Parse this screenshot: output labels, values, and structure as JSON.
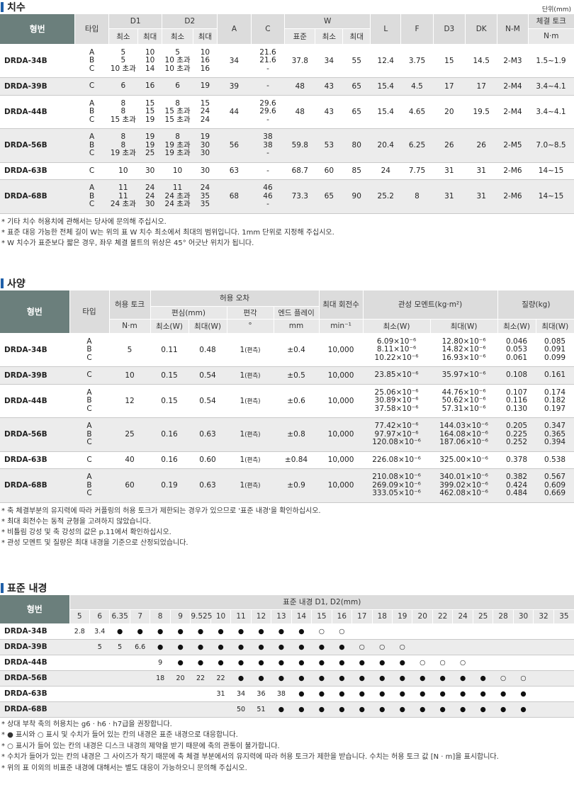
{
  "dimensions": {
    "title": "치수",
    "unit": "단위(mm)",
    "headers": {
      "model": "형번",
      "type": "타입",
      "d1": "D1",
      "d2": "D2",
      "min": "최소",
      "max": "최대",
      "a": "A",
      "c": "C",
      "w": "W",
      "std": "표준",
      "l": "L",
      "f": "F",
      "d3": "D3",
      "dk": "DK",
      "nm": "N-M",
      "torque": "체결 토크",
      "torque_unit": "N·m"
    },
    "rows": [
      {
        "model": "DRDA-34B",
        "types": [
          "A",
          "B",
          "C"
        ],
        "d1min": [
          "5",
          "5",
          "10 초과"
        ],
        "d1max": [
          "10",
          "10",
          "14"
        ],
        "d2min": [
          "5",
          "10 초과",
          "10 초과"
        ],
        "d2max": [
          "10",
          "16",
          "16"
        ],
        "a": "34",
        "c": [
          "21.6",
          "21.6",
          "-"
        ],
        "wstd": "37.8",
        "wmin": "34",
        "wmax": "55",
        "l": "12.4",
        "f": "3.75",
        "d3": "15",
        "dk": "14.5",
        "nm": "2-M3",
        "torque": "1.5~1.9"
      },
      {
        "model": "DRDA-39B",
        "types": [
          "C"
        ],
        "d1min": [
          "6"
        ],
        "d1max": [
          "16"
        ],
        "d2min": [
          "6"
        ],
        "d2max": [
          "19"
        ],
        "a": "39",
        "c": [
          "-"
        ],
        "wstd": "48",
        "wmin": "43",
        "wmax": "65",
        "l": "15.4",
        "f": "4.5",
        "d3": "17",
        "dk": "17",
        "nm": "2-M4",
        "torque": "3.4~4.1"
      },
      {
        "model": "DRDA-44B",
        "types": [
          "A",
          "B",
          "C"
        ],
        "d1min": [
          "8",
          "8",
          "15 초과"
        ],
        "d1max": [
          "15",
          "15",
          "19"
        ],
        "d2min": [
          "8",
          "15 초과",
          "15 초과"
        ],
        "d2max": [
          "15",
          "24",
          "24"
        ],
        "a": "44",
        "c": [
          "29.6",
          "29.6",
          "-"
        ],
        "wstd": "48",
        "wmin": "43",
        "wmax": "65",
        "l": "15.4",
        "f": "4.65",
        "d3": "20",
        "dk": "19.5",
        "nm": "2-M4",
        "torque": "3.4~4.1"
      },
      {
        "model": "DRDA-56B",
        "types": [
          "A",
          "B",
          "C"
        ],
        "d1min": [
          "8",
          "8",
          "19 초과"
        ],
        "d1max": [
          "19",
          "19",
          "25"
        ],
        "d2min": [
          "8",
          "19 초과",
          "19 초과"
        ],
        "d2max": [
          "19",
          "30",
          "30"
        ],
        "a": "56",
        "c": [
          "38",
          "38",
          "-"
        ],
        "wstd": "59.8",
        "wmin": "53",
        "wmax": "80",
        "l": "20.4",
        "f": "6.25",
        "d3": "26",
        "dk": "26",
        "nm": "2-M5",
        "torque": "7.0~8.5"
      },
      {
        "model": "DRDA-63B",
        "types": [
          "C"
        ],
        "d1min": [
          "10"
        ],
        "d1max": [
          "30"
        ],
        "d2min": [
          "10"
        ],
        "d2max": [
          "30"
        ],
        "a": "63",
        "c": [
          "-"
        ],
        "wstd": "68.7",
        "wmin": "60",
        "wmax": "85",
        "l": "24",
        "f": "7.75",
        "d3": "31",
        "dk": "31",
        "nm": "2-M6",
        "torque": "14~15"
      },
      {
        "model": "DRDA-68B",
        "types": [
          "A",
          "B",
          "C"
        ],
        "d1min": [
          "11",
          "11",
          "24 초과"
        ],
        "d1max": [
          "24",
          "24",
          "30"
        ],
        "d2min": [
          "11",
          "24 초과",
          "24 초과"
        ],
        "d2max": [
          "24",
          "35",
          "35"
        ],
        "a": "68",
        "c": [
          "46",
          "46",
          "-"
        ],
        "wstd": "73.3",
        "wmin": "65",
        "wmax": "90",
        "l": "25.2",
        "f": "8",
        "d3": "31",
        "dk": "31",
        "nm": "2-M6",
        "torque": "14~15"
      }
    ],
    "notes": [
      "* 기타 치수 허용치에 관해서는 당사에 문의해 주십시오.",
      "* 표준 대응 가능한 전체 길이 W는 위의 표 W 치수 최소에서 최대의 범위입니다. 1mm 단위로 지정해 주십시오.",
      "* W 치수가 표준보다 짧은 경우, 좌우 체결 볼트의 위상은 45° 어긋난 위치가 됩니다."
    ]
  },
  "specs": {
    "title": "사양",
    "headers": {
      "model": "형번",
      "type": "타입",
      "torque": "허용 토크",
      "torque_unit": "N·m",
      "tolerance": "허용 오차",
      "offset": "편심(mm)",
      "offset_min": "최소(W)",
      "offset_max": "최대(W)",
      "angle": "편각",
      "angle_unit": "°",
      "endplay": "엔드 플레이",
      "endplay_unit": "mm",
      "speed": "최대 회전수",
      "speed_unit": "min⁻¹",
      "inertia": "관성 모멘트(kg·m²)",
      "inertia_min": "최소(W)",
      "inertia_max": "최대(W)",
      "mass": "질량(kg)",
      "mass_min": "최소(W)",
      "mass_max": "최대(W)"
    },
    "rows": [
      {
        "model": "DRDA-34B",
        "types": [
          "A",
          "B",
          "C"
        ],
        "torque": "5",
        "off_min": "0.11",
        "off_max": "0.48",
        "angle": "1",
        "angle_note": "(편측)",
        "endplay": "±0.4",
        "speed": "10,000",
        "imin": [
          "6.09×10⁻⁶",
          "8.11×10⁻⁶",
          "10.22×10⁻⁶"
        ],
        "imax": [
          "12.80×10⁻⁶",
          "14.82×10⁻⁶",
          "16.93×10⁻⁶"
        ],
        "mmin": [
          "0.046",
          "0.053",
          "0.061"
        ],
        "mmax": [
          "0.085",
          "0.091",
          "0.099"
        ]
      },
      {
        "model": "DRDA-39B",
        "types": [
          "C"
        ],
        "torque": "10",
        "off_min": "0.15",
        "off_max": "0.54",
        "angle": "1",
        "angle_note": "(편측)",
        "endplay": "±0.5",
        "speed": "10,000",
        "imin": [
          "23.85×10⁻⁶"
        ],
        "imax": [
          "35.97×10⁻⁶"
        ],
        "mmin": [
          "0.108"
        ],
        "mmax": [
          "0.161"
        ]
      },
      {
        "model": "DRDA-44B",
        "types": [
          "A",
          "B",
          "C"
        ],
        "torque": "12",
        "off_min": "0.15",
        "off_max": "0.54",
        "angle": "1",
        "angle_note": "(편측)",
        "endplay": "±0.6",
        "speed": "10,000",
        "imin": [
          "25.06×10⁻⁶",
          "30.89×10⁻⁶",
          "37.58×10⁻⁶"
        ],
        "imax": [
          "44.76×10⁻⁶",
          "50.62×10⁻⁶",
          "57.31×10⁻⁶"
        ],
        "mmin": [
          "0.107",
          "0.116",
          "0.130"
        ],
        "mmax": [
          "0.174",
          "0.182",
          "0.197"
        ]
      },
      {
        "model": "DRDA-56B",
        "types": [
          "A",
          "B",
          "C"
        ],
        "torque": "25",
        "off_min": "0.16",
        "off_max": "0.63",
        "angle": "1",
        "angle_note": "(편측)",
        "endplay": "±0.8",
        "speed": "10,000",
        "imin": [
          "77.42×10⁻⁶",
          "97.97×10⁻⁶",
          "120.08×10⁻⁶"
        ],
        "imax": [
          "144.03×10⁻⁶",
          "164.08×10⁻⁶",
          "187.06×10⁻⁶"
        ],
        "mmin": [
          "0.205",
          "0.225",
          "0.252"
        ],
        "mmax": [
          "0.347",
          "0.365",
          "0.394"
        ]
      },
      {
        "model": "DRDA-63B",
        "types": [
          "C"
        ],
        "torque": "40",
        "off_min": "0.16",
        "off_max": "0.60",
        "angle": "1",
        "angle_note": "(편측)",
        "endplay": "±0.84",
        "speed": "10,000",
        "imin": [
          "226.08×10⁻⁶"
        ],
        "imax": [
          "325.00×10⁻⁶"
        ],
        "mmin": [
          "0.378"
        ],
        "mmax": [
          "0.538"
        ]
      },
      {
        "model": "DRDA-68B",
        "types": [
          "A",
          "B",
          "C"
        ],
        "torque": "60",
        "off_min": "0.19",
        "off_max": "0.63",
        "angle": "1",
        "angle_note": "(편측)",
        "endplay": "±0.9",
        "speed": "10,000",
        "imin": [
          "210.08×10⁻⁶",
          "269.09×10⁻⁶",
          "333.05×10⁻⁶"
        ],
        "imax": [
          "340.01×10⁻⁶",
          "399.02×10⁻⁶",
          "462.08×10⁻⁶"
        ],
        "mmin": [
          "0.382",
          "0.424",
          "0.484"
        ],
        "mmax": [
          "0.567",
          "0.609",
          "0.669"
        ]
      }
    ],
    "notes": [
      "* 축 체결부분의 유지력에 따라 커플링의 허용 토크가 제한되는 경우가 있으므로 '표준 내경'을 확인하십시오.",
      "* 최대 회전수는 동적 균형을 고려하지 않았습니다.",
      "* 비틀림 강성 및 축 강성의 값은 p.11에서 확인하십시오.",
      "* 관성 모멘트 및 질량은 최대 내경을 기준으로 산정되었습니다."
    ]
  },
  "bores": {
    "title": "표준 내경",
    "model_header": "형번",
    "bore_header": "표준 내경 D1, D2(mm)",
    "sizes": [
      "5",
      "6",
      "6.35",
      "7",
      "8",
      "9",
      "9.525",
      "10",
      "11",
      "12",
      "13",
      "14",
      "15",
      "16",
      "17",
      "18",
      "19",
      "20",
      "22",
      "24",
      "25",
      "28",
      "30",
      "32",
      "35"
    ],
    "rows": [
      {
        "model": "DRDA-34B",
        "cells": [
          "2.8",
          "3.4",
          "●",
          "●",
          "●",
          "●",
          "●",
          "●",
          "●",
          "●",
          "●",
          "●",
          "○",
          "○",
          "",
          "",
          "",
          "",
          "",
          "",
          "",
          "",
          "",
          "",
          ""
        ]
      },
      {
        "model": "DRDA-39B",
        "cells": [
          "",
          "5",
          "5",
          "6.6",
          "●",
          "●",
          "●",
          "●",
          "●",
          "●",
          "●",
          "●",
          "●",
          "●",
          "○",
          "○",
          "○",
          "",
          "",
          "",
          "",
          "",
          "",
          "",
          ""
        ]
      },
      {
        "model": "DRDA-44B",
        "cells": [
          "",
          "",
          "",
          "",
          "9",
          "●",
          "●",
          "●",
          "●",
          "●",
          "●",
          "●",
          "●",
          "●",
          "●",
          "●",
          "●",
          "○",
          "○",
          "○",
          "",
          "",
          "",
          "",
          ""
        ]
      },
      {
        "model": "DRDA-56B",
        "cells": [
          "",
          "",
          "",
          "",
          "18",
          "20",
          "22",
          "22",
          "●",
          "●",
          "●",
          "●",
          "●",
          "●",
          "●",
          "●",
          "●",
          "●",
          "●",
          "●",
          "●",
          "○",
          "○",
          "",
          ""
        ]
      },
      {
        "model": "DRDA-63B",
        "cells": [
          "",
          "",
          "",
          "",
          "",
          "",
          "",
          "31",
          "34",
          "36",
          "38",
          "●",
          "●",
          "●",
          "●",
          "●",
          "●",
          "●",
          "●",
          "●",
          "●",
          "●",
          "●",
          "",
          ""
        ]
      },
      {
        "model": "DRDA-68B",
        "cells": [
          "",
          "",
          "",
          "",
          "",
          "",
          "",
          "",
          "50",
          "51",
          "●",
          "●",
          "●",
          "●",
          "●",
          "●",
          "●",
          "●",
          "●",
          "●",
          "●",
          "●",
          "●",
          "",
          ""
        ]
      }
    ],
    "notes": [
      "* 상대 부착 축의 허용치는 g6 · h6 · h7급을 권장합니다.",
      "* ● 표시와 ○ 표시 및 수치가 들어 있는 칸의 내경은 표준 내경으로 대응합니다.",
      "* ○ 표시가 들어 있는 칸의 내경은 디스크 내경의 제약을 받기 때문에 축의 관통이 불가합니다.",
      "* 수치가 들어가 있는 칸의 내경은 그 사이즈가 작기 때문에 축 체결 부분에서의 유지력에 따라 허용 토크가 제한을 받습니다. 수치는 허용 토크 값 [N · m]을 표시합니다.",
      "* 위의 표 이외의 비표준 내경에 대해서는 별도 대응이 가능하오니 문의해 주십시오."
    ]
  }
}
